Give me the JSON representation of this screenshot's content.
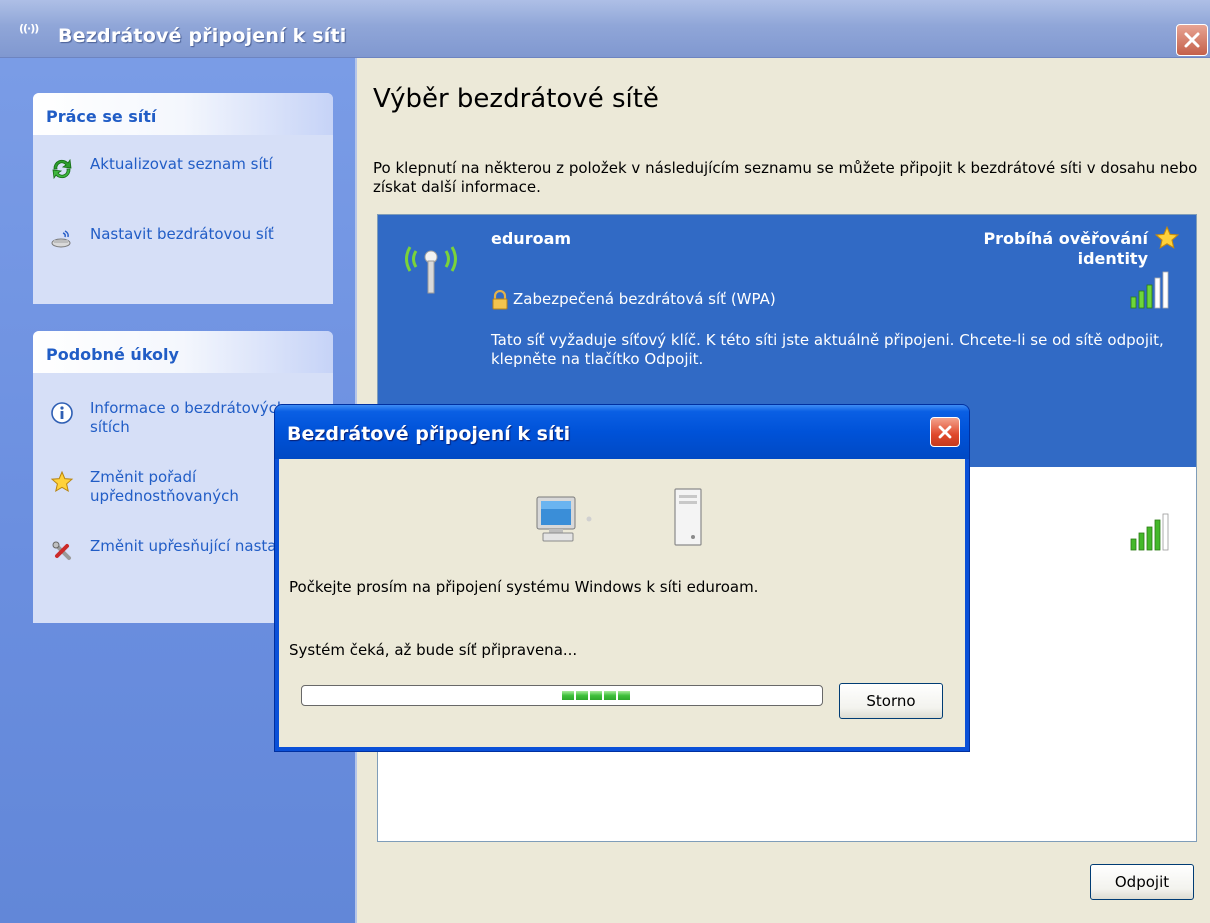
{
  "window": {
    "title": "Bezdrátové připojení k síti",
    "title_icon": "((·))",
    "close_icon": "close-icon"
  },
  "sidebar": {
    "network_tasks": {
      "title": "Práce se sítí",
      "items": [
        {
          "label": "Aktualizovat seznam sítí",
          "icon": "refresh-icon"
        },
        {
          "label": "Nastavit bezdrátovou síť",
          "icon": "setup-wireless-icon"
        }
      ]
    },
    "related_tasks": {
      "title": "Podobné úkoly",
      "items": [
        {
          "label": "Informace o bezdrátových sítích",
          "icon": "info-icon"
        },
        {
          "label": "Změnit pořadí upřednostňovaných",
          "icon": "star-icon"
        },
        {
          "label": "Změnit upřesňující nastavení",
          "icon": "settings-icon"
        }
      ]
    }
  },
  "content": {
    "title": "Výběr bezdrátové sítě",
    "description": "Po klepnutí na některou z položek v následujícím seznamu se můžete připojit k bezdrátové síti v dosahu nebo získat další informace.",
    "networks": [
      {
        "name": "eduroam",
        "status": "Probíhá ověřování identity",
        "security": "Zabezpečená bezdrátová síť (WPA)",
        "description": "Tato síť vyžaduje síťový klíč. K této síti jste aktuálně připojeni. Chcete-li se od sítě odpojit, klepněte na tlačítko Odpojit.",
        "signal_bars": 5,
        "selected": true
      },
      {
        "name": "",
        "signal_bars": 4,
        "selected": false
      }
    ],
    "disconnect_button": "Odpojit"
  },
  "dialog": {
    "title": "Bezdrátové připojení k síti",
    "message": "Počkejte prosím na připojení systému Windows k síti eduroam.",
    "status": "Systém čeká, až bude síť připravena...",
    "cancel_button": "Storno",
    "progress_blocks": 5
  },
  "colors": {
    "sidebar_bg": "#6b8fe0",
    "selection": "#316ac5",
    "link": "#215dc6",
    "dialog_title": "#0052d8",
    "progress": "#3fc03c"
  }
}
